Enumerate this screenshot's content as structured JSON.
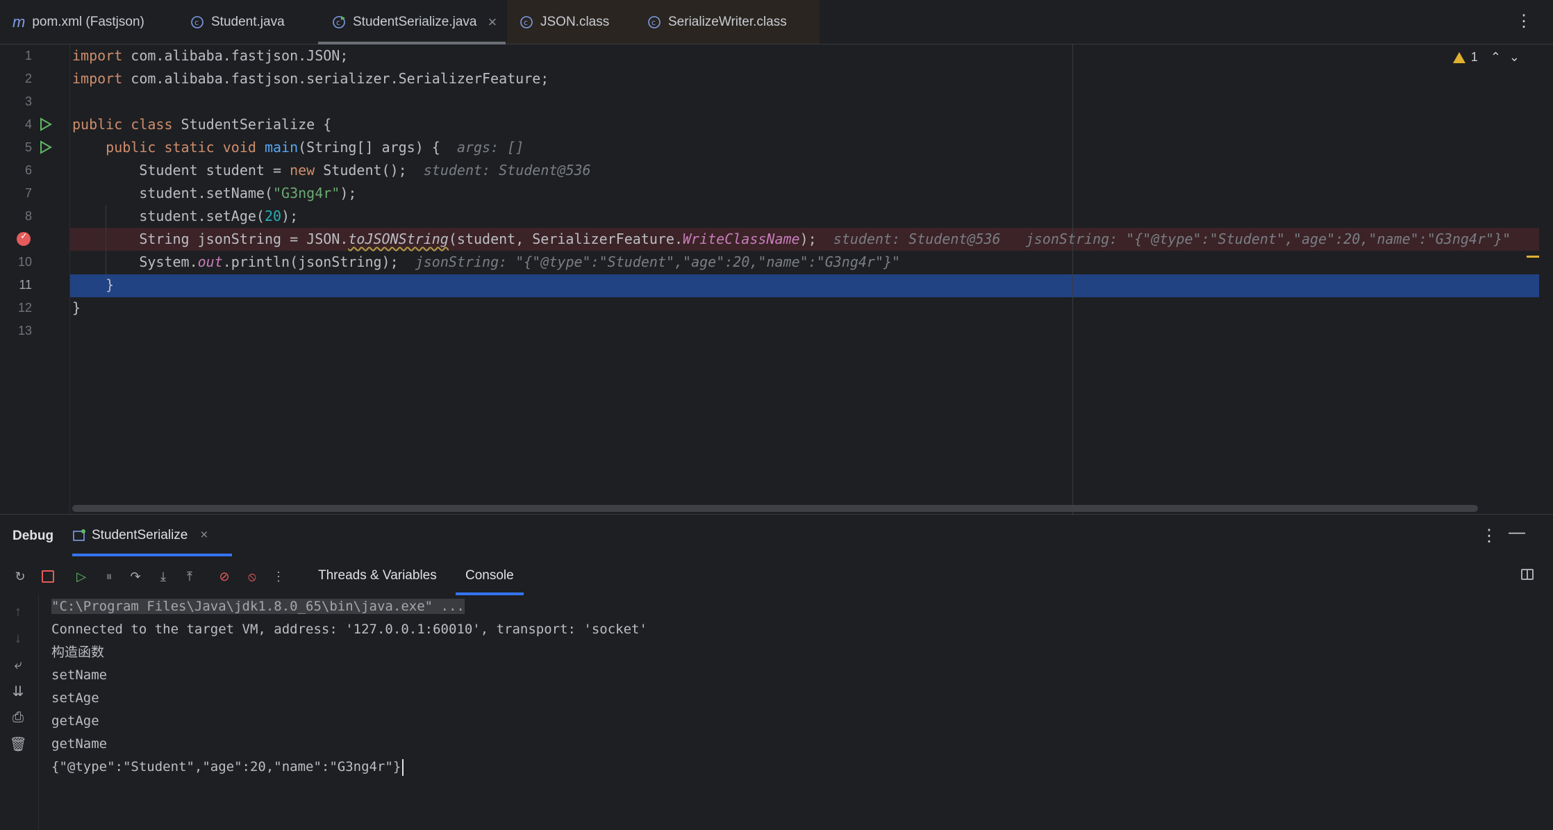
{
  "tabs": [
    {
      "label": "pom.xml (Fastjson)",
      "icon": "maven-icon"
    },
    {
      "label": "Student.java",
      "icon": "class-icon"
    },
    {
      "label": "StudentSerialize.java",
      "icon": "class-run-icon",
      "active": true
    },
    {
      "label": "JSON.class",
      "icon": "class-icon"
    },
    {
      "label": "SerializeWriter.class",
      "icon": "class-icon"
    }
  ],
  "editor": {
    "warning_count": "1",
    "lines": [
      "1",
      "2",
      "3",
      "4",
      "5",
      "6",
      "7",
      "8",
      "9",
      "10",
      "11",
      "12",
      "13"
    ],
    "code": {
      "l1_kw": "import",
      "l1_rest": " com.alibaba.fastjson.JSON;",
      "l2_kw": "import",
      "l2_rest": " com.alibaba.fastjson.serializer.SerializerFeature;",
      "l4_kw": "public class",
      "l4_rest": " StudentSerialize {",
      "l5_kw": "public static void",
      "l5_fn": "main",
      "l5_rest": "(String[] args) {",
      "l5_hint": "args: []",
      "l6_a": "Student student = ",
      "l6_kw": "new",
      "l6_b": " Student();",
      "l6_hint": "student: Student@536",
      "l7_a": "student.setName(",
      "l7_str": "\"G3ng4r\"",
      "l7_b": ");",
      "l8_a": "student.setAge(",
      "l8_num": "20",
      "l8_b": ");",
      "l9_a": "String jsonString = JSON.",
      "l9_fn": "toJSONString",
      "l9_b": "(student, SerializerFeature.",
      "l9_field": "WriteClassName",
      "l9_c": ");",
      "l9_hint1": "student: Student@536",
      "l9_hint2": "jsonString: \"{\"@type\":\"Student\",\"age\":20,\"name\":\"G3ng4r\"}\"",
      "l10_a": "System.",
      "l10_field": "out",
      "l10_b": ".println(jsonString);",
      "l10_hint": "jsonString: \"{\"@type\":\"Student\",\"age\":20,\"name\":\"G3ng4r\"}\"",
      "l11": "}",
      "l12": "}"
    }
  },
  "debug": {
    "title": "Debug",
    "session": "StudentSerialize",
    "subtabs": [
      "Threads & Variables",
      "Console"
    ],
    "console_lines": [
      "\"C:\\Program Files\\Java\\jdk1.8.0_65\\bin\\java.exe\" ...",
      "Connected to the target VM, address: '127.0.0.1:60010', transport: 'socket'",
      "构造函数",
      "setName",
      "setAge",
      "getAge",
      "getName",
      "{\"@type\":\"Student\",\"age\":20,\"name\":\"G3ng4r\"}"
    ]
  }
}
